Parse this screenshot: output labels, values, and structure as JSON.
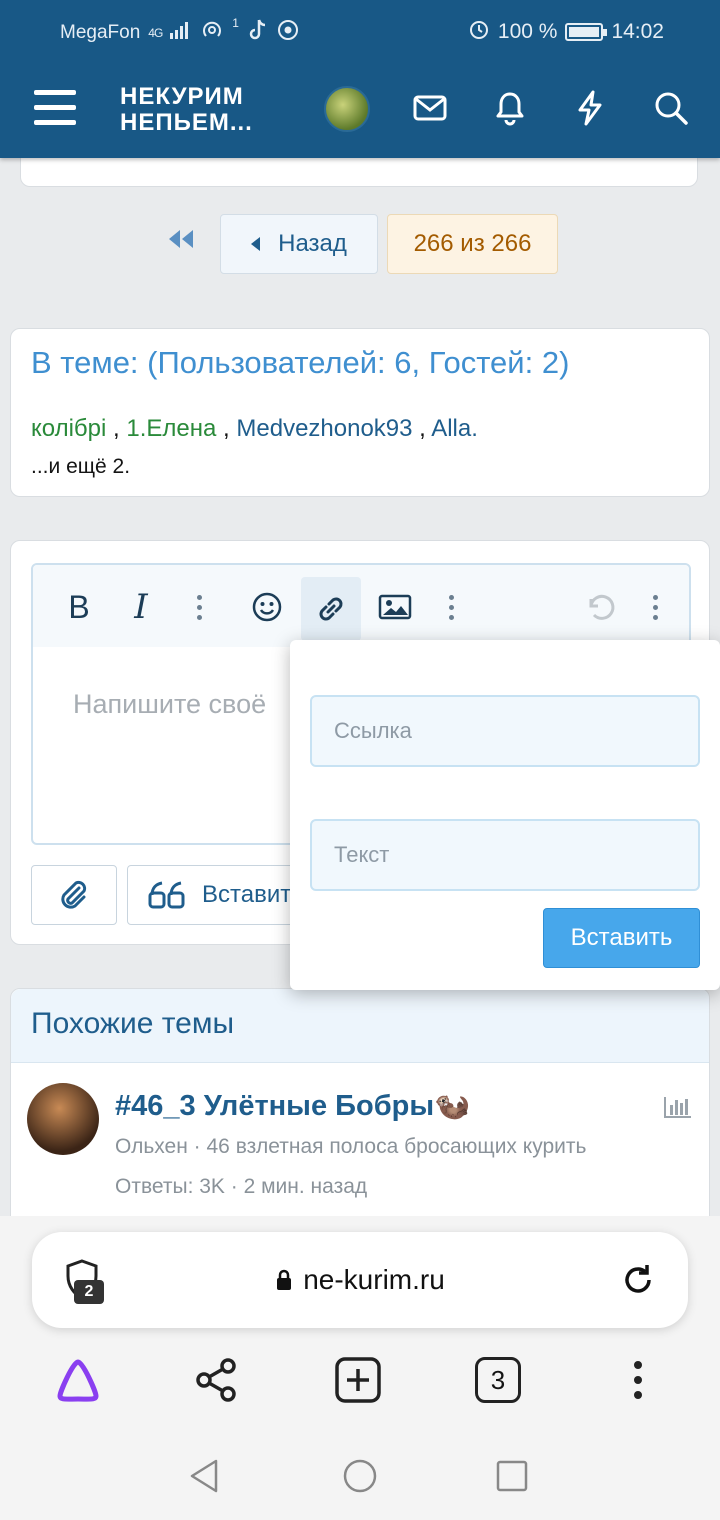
{
  "status_bar": {
    "carrier": "MegaFon",
    "network": "4G",
    "notification_count": "1",
    "battery": "100 %",
    "time": "14:02"
  },
  "header": {
    "logo_line1": "НЕКУРИМ",
    "logo_line2": "НЕПЬЕМ...",
    "icons": [
      "menu-icon",
      "avatar",
      "mail-icon",
      "bell-icon",
      "lightning-icon",
      "search-icon"
    ]
  },
  "pagination": {
    "back_label": "Назад",
    "page_info": "266 из 266"
  },
  "online": {
    "title": "В теме: (Пользователей: 6, Гостей: 2)",
    "users": [
      "колібрі",
      "1.Елена",
      "Medvezhonok93",
      "Alla."
    ],
    "more": "...и ещё 2."
  },
  "editor": {
    "placeholder": "Напишите своё",
    "quote_label": "Вставить"
  },
  "link_popup": {
    "url_placeholder": "Ссылка",
    "text_placeholder": "Текст",
    "insert_label": "Вставить"
  },
  "similar": {
    "title": "Похожие темы",
    "thread_title": "#46_3 Улётные Бобры🦦",
    "thread_meta1": "Ольхен · 46 взлетная полоса бросающих курить",
    "thread_meta2": "Ответы: 3K · 2 мин. назад"
  },
  "browser": {
    "url": "ne-kurim.ru",
    "shield_count": "2",
    "tabs_count": "3"
  },
  "colors": {
    "header_bg": "#185886",
    "link_blue": "#1f5d8c",
    "accent_button": "#47a7eb",
    "user_green": "#2a8a3a"
  }
}
